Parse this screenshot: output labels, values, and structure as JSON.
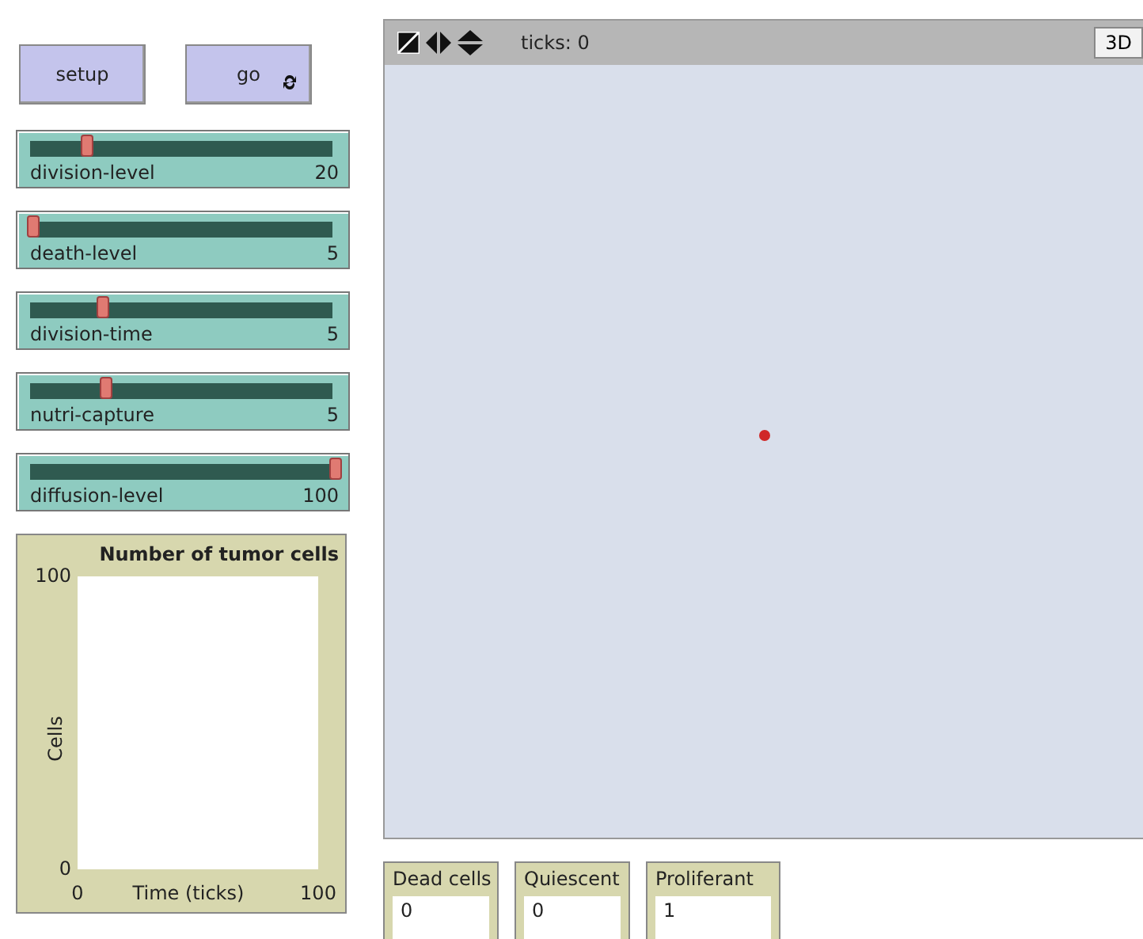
{
  "buttons": [
    {
      "label": "setup",
      "kind": "once"
    },
    {
      "label": "go",
      "kind": "forever"
    }
  ],
  "sliders": [
    {
      "name": "division-level",
      "value": "20",
      "level": 0.18
    },
    {
      "name": "death-level",
      "value": "5",
      "level": 0.0
    },
    {
      "name": "division-time",
      "value": "5",
      "level": 0.23
    },
    {
      "name": "nutri-capture",
      "value": "5",
      "level": 0.24
    },
    {
      "name": "diffusion-level",
      "value": "100",
      "level": 1.0
    }
  ],
  "plot": {
    "chart_data": {
      "type": "line",
      "title": "Number of tumor cells",
      "xlabel": "Time (ticks)",
      "ylabel": "Cells",
      "xlim": [
        0,
        100
      ],
      "ylim": [
        0,
        100
      ],
      "xticks": [
        0,
        100
      ],
      "yticks": [
        0,
        100
      ]
    }
  },
  "world": {
    "ticks_label": "ticks: 0",
    "view_button": "3D",
    "agents": [
      {
        "color": "#d02828"
      }
    ]
  },
  "monitors": [
    {
      "label": "Dead cells",
      "value": "0"
    },
    {
      "label": "Quiescent",
      "value": "0"
    },
    {
      "label": "Proliferant",
      "value": "1"
    }
  ]
}
